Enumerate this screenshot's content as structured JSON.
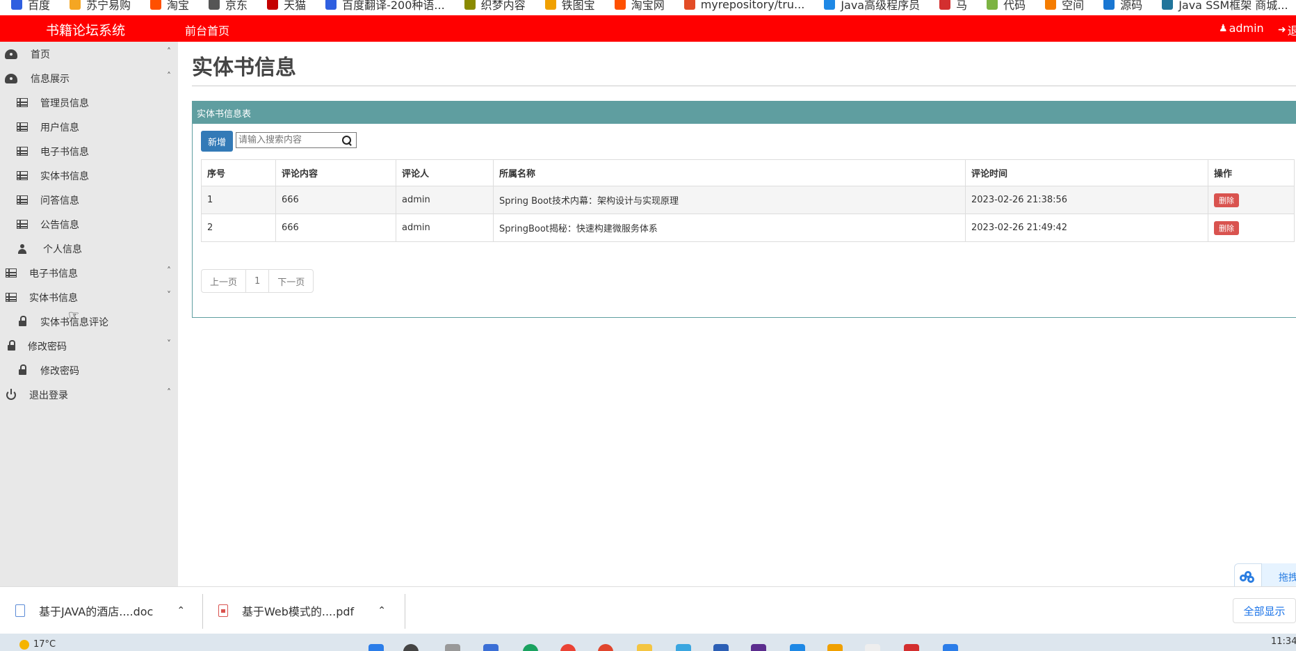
{
  "bookmarks": [
    {
      "label": "百度",
      "color": "#2f5fe0"
    },
    {
      "label": "苏宁易购",
      "color": "#f5a623"
    },
    {
      "label": "淘宝",
      "color": "#ff5000"
    },
    {
      "label": "京东",
      "color": "#555555"
    },
    {
      "label": "天猫",
      "color": "#c40000"
    },
    {
      "label": "百度翻译-200种语...",
      "color": "#2f5fe0"
    },
    {
      "label": "织梦内容",
      "color": "#8a8a00"
    },
    {
      "label": "铁图宝",
      "color": "#f0a000"
    },
    {
      "label": "淘宝网",
      "color": "#ff5000"
    },
    {
      "label": "myrepository/tru...",
      "color": "#e34c26"
    },
    {
      "label": "Java高级程序员",
      "color": "#1e88e5"
    },
    {
      "label": "马",
      "color": "#d32f2f"
    },
    {
      "label": "代码",
      "color": "#7cb342"
    },
    {
      "label": "空间",
      "color": "#f57c00"
    },
    {
      "label": "源码",
      "color": "#1976d2"
    },
    {
      "label": "Java SSM框架 商城...",
      "color": "#21759b"
    }
  ],
  "header": {
    "brand": "书籍论坛系统",
    "home_link": "前台首页",
    "user": "admin",
    "logout": "退"
  },
  "sidebar": {
    "items": [
      {
        "label": "首页",
        "icon": "dashboard-icon",
        "chevron": "^"
      },
      {
        "label": "信息展示",
        "icon": "dashboard-icon",
        "chevron": "^"
      },
      {
        "label": "管理员信息",
        "icon": "table-icon"
      },
      {
        "label": "用户信息",
        "icon": "table-icon"
      },
      {
        "label": "电子书信息",
        "icon": "table-icon"
      },
      {
        "label": "实体书信息",
        "icon": "table-icon"
      },
      {
        "label": "问答信息",
        "icon": "table-icon"
      },
      {
        "label": "公告信息",
        "icon": "table-icon"
      },
      {
        "label": "个人信息",
        "icon": "user-icon"
      },
      {
        "label": "电子书信息",
        "icon": "table-icon",
        "chevron": "^"
      },
      {
        "label": "实体书信息",
        "icon": "table-icon",
        "chevron": "v"
      },
      {
        "label": "实体书信息评论",
        "icon": "lock-icon"
      },
      {
        "label": "修改密码",
        "icon": "lock-icon",
        "chevron": "v"
      },
      {
        "label": "修改密码",
        "icon": "lock-icon"
      },
      {
        "label": "退出登录",
        "icon": "power-icon",
        "chevron": "^"
      }
    ]
  },
  "main": {
    "page_title": "实体书信息",
    "panel_title": "实体书信息表",
    "add_button": "新增",
    "search_placeholder": "请输入搜索内容",
    "table": {
      "headers": [
        "序号",
        "评论内容",
        "评论人",
        "所属名称",
        "评论时间",
        "操作"
      ],
      "rows": [
        {
          "index": "1",
          "content": "666",
          "user": "admin",
          "book": "Spring Boot技术内幕：架构设计与实现原理",
          "time": "2023-02-26 21:38:56",
          "action": "删除"
        },
        {
          "index": "2",
          "content": "666",
          "user": "admin",
          "book": "SpringBoot揭秘：快速构建微服务体系",
          "time": "2023-02-26 21:49:42",
          "action": "删除"
        }
      ]
    },
    "pager": {
      "prev": "上一页",
      "page": "1",
      "next": "下一页"
    }
  },
  "float_widget": {
    "label": "拖拽"
  },
  "downloads": {
    "items": [
      {
        "name": "基于JAVA的酒店....doc",
        "icon": "doc-icon"
      },
      {
        "name": "基于Web模式的....pdf",
        "icon": "pdf-icon"
      }
    ],
    "show_all": "全部显示"
  },
  "taskbar": {
    "weather": "17°C",
    "clock": "11:34"
  },
  "colors": {
    "header_red": "#ff0000",
    "panel_teal": "#5f9ea0",
    "add_blue": "#337ab7",
    "delete_red": "#d9534f"
  }
}
